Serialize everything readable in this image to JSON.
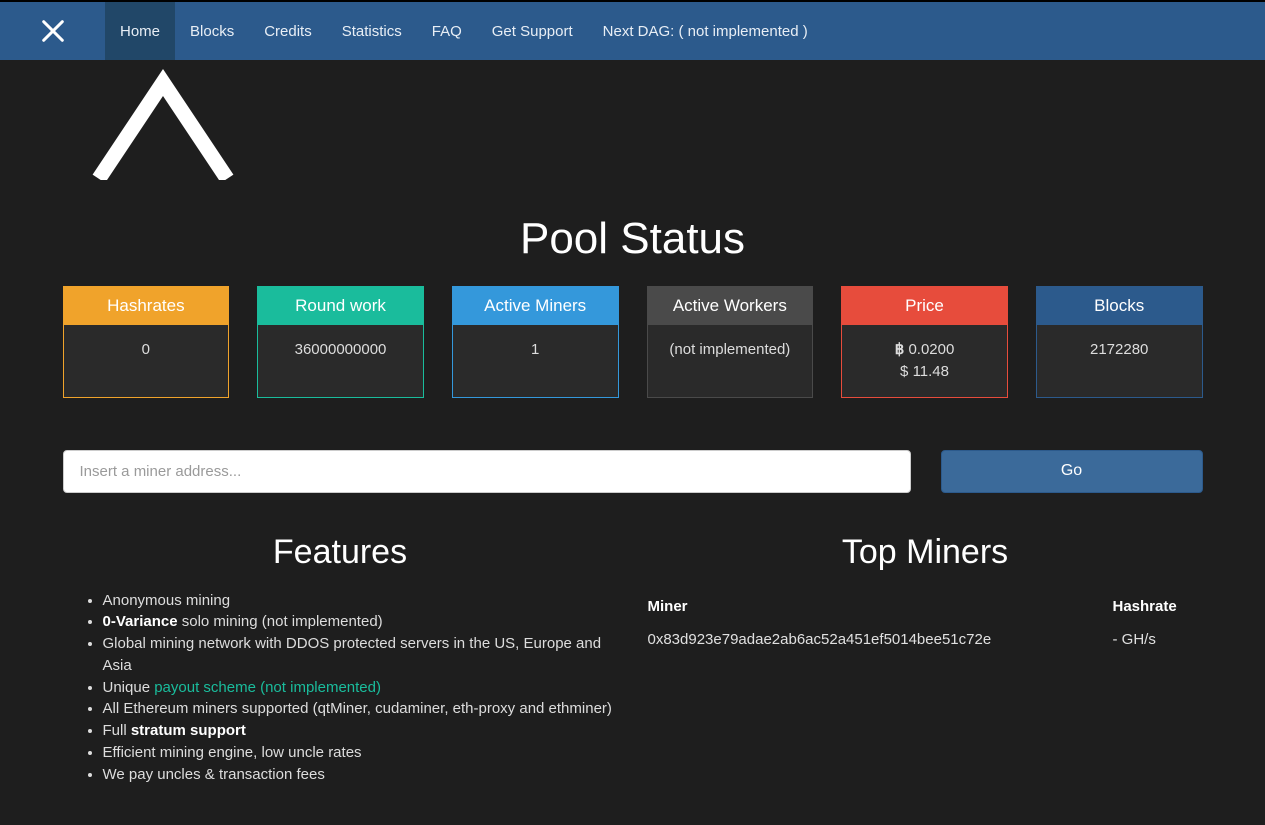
{
  "nav": {
    "items": [
      {
        "label": "Home",
        "active": true
      },
      {
        "label": "Blocks"
      },
      {
        "label": "Credits"
      },
      {
        "label": "Statistics"
      },
      {
        "label": "FAQ"
      },
      {
        "label": "Get Support"
      },
      {
        "label": "Next DAG: ( not implemented )"
      }
    ]
  },
  "title": "Pool Status",
  "stats": {
    "hashrates": {
      "label": "Hashrates",
      "value": "0"
    },
    "roundwork": {
      "label": "Round work",
      "value": "36000000000"
    },
    "miners": {
      "label": "Active Miners",
      "value": "1"
    },
    "workers": {
      "label": "Active Workers",
      "value": "(not implemented)"
    },
    "price": {
      "label": "Price",
      "btc": "0.0200",
      "usd": "11.48"
    },
    "blocks": {
      "label": "Blocks",
      "value": "2172280"
    }
  },
  "search": {
    "placeholder": "Insert a miner address...",
    "button": "Go"
  },
  "features": {
    "title": "Features",
    "f1": "Anonymous mining",
    "f2a": "0-Variance",
    "f2b": " solo mining (not implemented)",
    "f3": "Global mining network with DDOS protected servers in the US, Europe and Asia",
    "f4a": "Unique ",
    "f4b": "payout scheme (not implemented)",
    "f5": "All Ethereum miners supported (qtMiner, cudaminer, eth-proxy and ethminer)",
    "f6a": "Full ",
    "f6b": "stratum support",
    "f7": "Efficient mining engine, low uncle rates",
    "f8": "We pay uncles & transaction fees"
  },
  "topminers": {
    "title": "Top Miners",
    "col_miner": "Miner",
    "col_hash": "Hashrate",
    "rows": [
      {
        "miner": "0x83d923e79adae2ab6ac52a451ef5014bee51c72e",
        "hash": "- GH/s"
      }
    ]
  }
}
